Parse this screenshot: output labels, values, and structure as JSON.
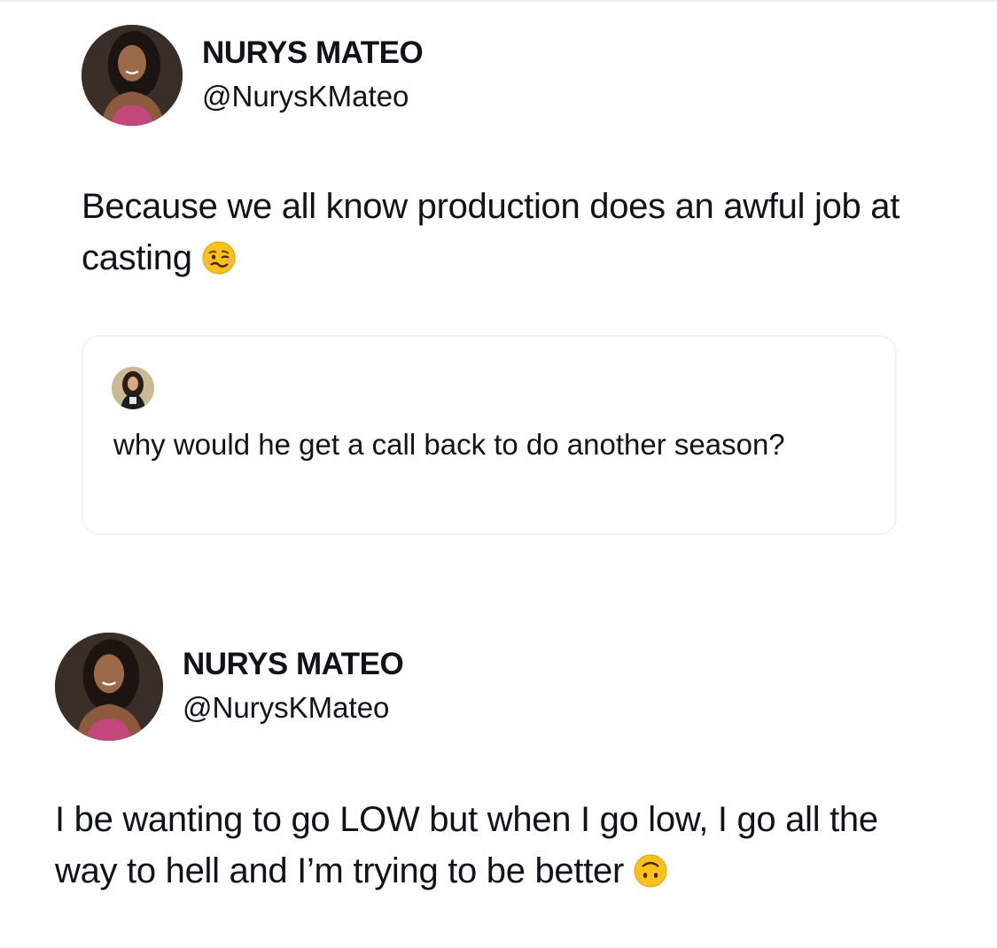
{
  "tweets": [
    {
      "display_name": "NURYS MATEO",
      "handle": "@NurysKMateo",
      "text": "Because we all know production does an awful job at casting",
      "emoji": "woozy-face-emoji",
      "quoted": {
        "text": "why would he get a call back to do another season?"
      }
    },
    {
      "display_name": "NURYS MATEO",
      "handle": "@NurysKMateo",
      "text": "I be wanting to go LOW but when I go low, I go all the way to hell and I’m trying to be better",
      "emoji": "upside-down-face-emoji"
    }
  ],
  "colors": {
    "text": "#0f1419",
    "card_border": "#eff3f4",
    "emoji_yellow": "#fcc21b"
  }
}
